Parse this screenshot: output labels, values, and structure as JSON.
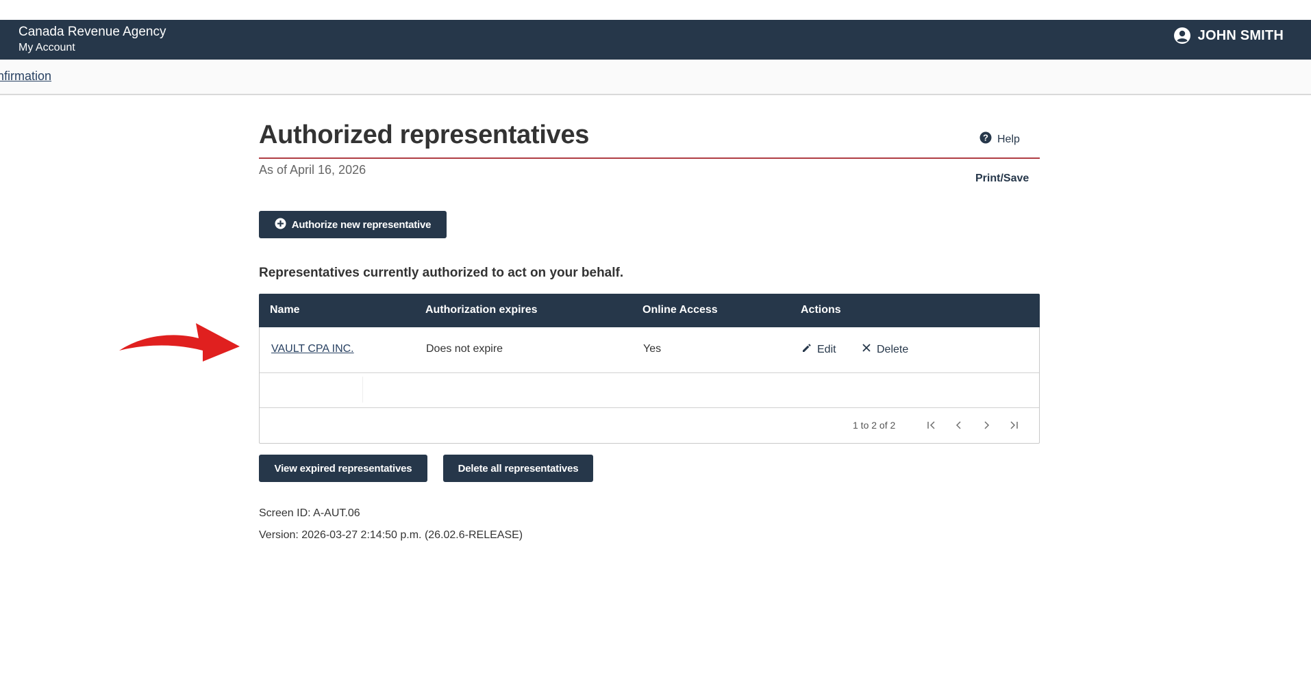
{
  "header": {
    "agency": "Canada Revenue Agency",
    "account": "My Account",
    "user_name": "JOHN SMITH"
  },
  "breadcrumb": {
    "link": "nfirmation"
  },
  "page": {
    "title": "Authorized representatives",
    "help_label": "Help",
    "as_of": "As of April 16, 2026",
    "print_save": "Print/Save",
    "authorize_button": "Authorize new representative",
    "section_heading": "Representatives currently authorized to act on your behalf."
  },
  "table": {
    "headers": [
      "Name",
      "Authorization expires",
      "Online Access",
      "Actions"
    ],
    "rows": [
      {
        "name": "VAULT CPA INC.",
        "expires": "Does not expire",
        "online_access": "Yes",
        "edit": "Edit",
        "delete": "Delete"
      }
    ],
    "pagination": "1 to 2 of 2"
  },
  "buttons": {
    "view_expired": "View expired representatives",
    "delete_all": "Delete all representatives"
  },
  "footer": {
    "screen_id": "Screen ID: A-AUT.06",
    "version": "Version: 2026-03-27 2:14:50 p.m. (26.02.6-RELEASE)"
  },
  "colors": {
    "header_bg": "#26374a",
    "title_rule": "#af3c43",
    "link": "#284162",
    "annotation_arrow": "#e0201f"
  },
  "icons": {
    "user": "user-circle-icon",
    "help": "question-circle-icon",
    "add": "plus-circle-icon",
    "edit": "pencil-icon",
    "delete": "close-icon",
    "first": "first-page-icon",
    "prev": "chevron-left-icon",
    "next": "chevron-right-icon",
    "last": "last-page-icon",
    "annotation": "red-arrow-icon"
  }
}
